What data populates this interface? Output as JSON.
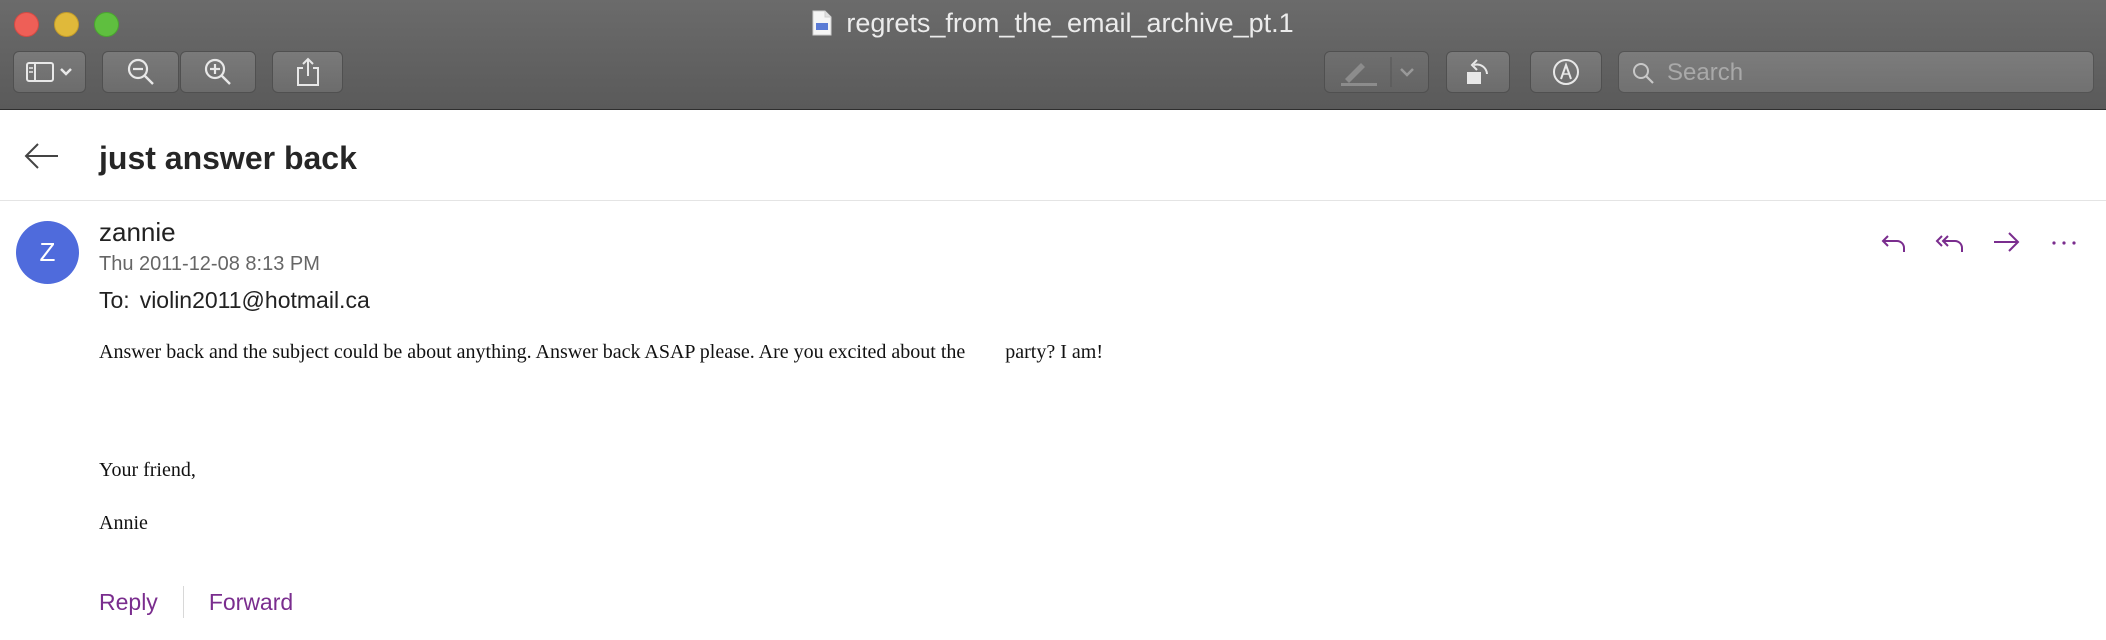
{
  "window": {
    "title": "regrets_from_the_email_archive_pt.1"
  },
  "toolbar": {
    "search_placeholder": "Search"
  },
  "email": {
    "subject": "just answer back",
    "avatar_initial": "Z",
    "sender": "zannie",
    "datetime": "Thu 2011-12-08 8:13 PM",
    "to_label": "To:",
    "to_address": "violin2011@hotmail.ca",
    "body_line1_part1": "Answer back and the subject could be about anything. Answer back ASAP please. Are you excited about the",
    "body_line1_part2": "party? I am!",
    "body_line2": "Your friend,",
    "body_line3": "Annie"
  },
  "footer": {
    "reply_label": "Reply",
    "forward_label": "Forward"
  },
  "colors": {
    "accent_purple": "#7a2d8e",
    "avatar_blue": "#4f6bdc",
    "toolbar_gray": "#5f5f5f"
  }
}
